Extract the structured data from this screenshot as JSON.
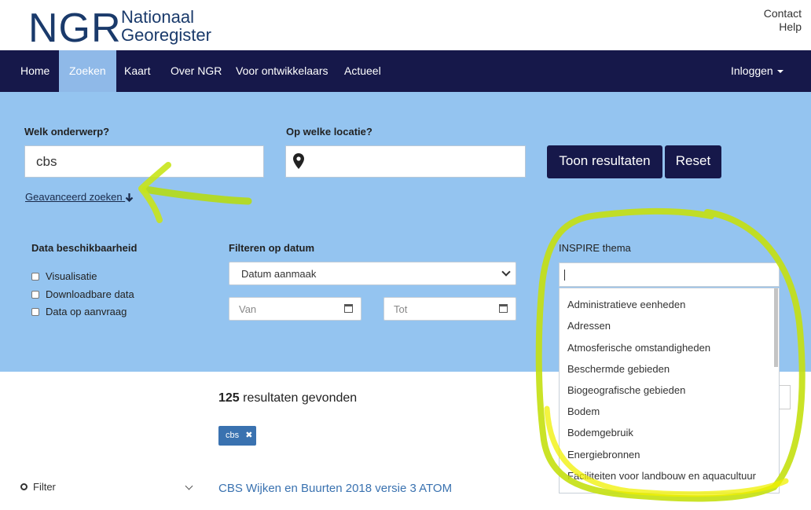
{
  "header": {
    "logo_big": "NGR",
    "logo_line1": "Nationaal",
    "logo_line2": "Georegister",
    "links": [
      "Contact",
      "Help"
    ]
  },
  "nav": {
    "items": [
      "Home",
      "Zoeken",
      "Kaart",
      "Over NGR",
      "Voor ontwikkelaars",
      "Actueel"
    ],
    "active": "Zoeken",
    "login": "Inloggen"
  },
  "search": {
    "subject_label": "Welk onderwerp?",
    "subject_value": "cbs",
    "location_label": "Op welke locatie?",
    "location_value": "",
    "show_results": "Toon resultaten",
    "reset": "Reset",
    "advanced": "Geavanceerd zoeken"
  },
  "filters": {
    "availability_label": "Data beschikbaarheid",
    "availability_options": [
      "Visualisatie",
      "Downloadbare data",
      "Data op aanvraag"
    ],
    "date_label": "Filteren op datum",
    "date_select": "Datum aanmaak",
    "from_placeholder": "Van",
    "to_placeholder": "Tot",
    "inspire_label": "INSPIRE thema",
    "inspire_options": [
      "Administratieve eenheden",
      "Adressen",
      "Atmosferische omstandigheden",
      "Beschermde gebieden",
      "Biogeografische gebieden",
      "Bodem",
      "Bodemgebruik",
      "Energiebronnen",
      "Faciliteiten voor landbouw en aquacultuur"
    ]
  },
  "results": {
    "count": "125",
    "count_text": "resultaten gevonden",
    "tag": "cbs",
    "first_title": "CBS Wijken en Buurten 2018 versie 3 ATOM",
    "filter_label": "Filter"
  },
  "colors": {
    "nav_bg": "#16184a",
    "panel_bg": "#94c4f0",
    "annotation": "#b9e000"
  }
}
